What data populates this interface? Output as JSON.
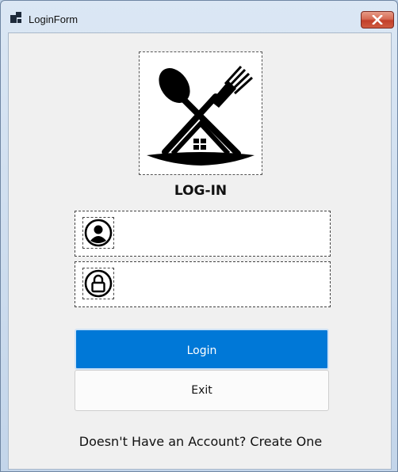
{
  "window": {
    "title": "LoginForm"
  },
  "icons": {
    "app": "app-window-icon",
    "close": "close-icon",
    "logo": "spoon-fork-house-logo",
    "username": "user-circle-icon",
    "password": "lock-circle-icon"
  },
  "form": {
    "heading": "LOG-IN",
    "username": {
      "value": "",
      "placeholder": ""
    },
    "password": {
      "value": "",
      "placeholder": ""
    },
    "login_label": "Login",
    "exit_label": "Exit",
    "signup_text": "Doesn't Have an Account? Create One"
  },
  "colors": {
    "primary": "#0078d7",
    "close": "#c7432b",
    "background": "#f0f0f0"
  }
}
